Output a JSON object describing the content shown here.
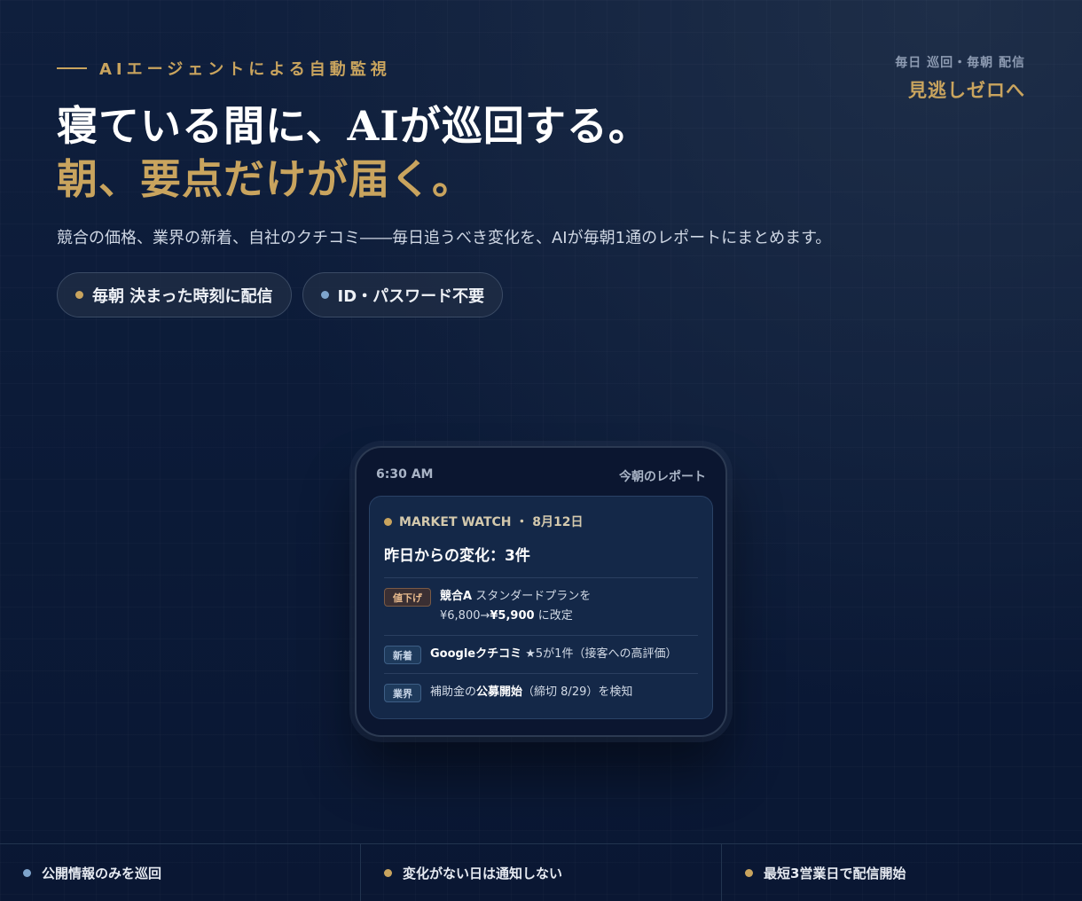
{
  "hero": {
    "eyebrow": "AIエージェントによる自動監視",
    "corner_sub": "毎日 巡回・毎朝 配信",
    "corner_main": "見逃しゼロへ",
    "headline_line1": "寝ている間に、AIが巡回する。",
    "headline_line2": "朝、要点だけが届く。",
    "lead": "競合の価格、業界の新着、自社のクチコミ――毎日追うべき変化を、AIが毎朝1通のレポートにまとめます。",
    "pills": [
      {
        "label": "毎朝 決まった時刻に配信",
        "dot_color": "#c9a45e"
      },
      {
        "label": "ID・パスワード不要",
        "dot_color": "#7ea4cc"
      }
    ]
  },
  "phone": {
    "time": "6:30 AM",
    "title": "今朝のレポート",
    "card": {
      "source": "MARKET WATCH ・ 8月12日",
      "headline": "昨日からの変化：3件",
      "items": [
        {
          "tag": "値下げ",
          "subject": "競合A",
          "text1": " スタンダードプランを",
          "text2a": "¥6,800→",
          "text2b": "¥5,900",
          "text2c": " に改定"
        },
        {
          "tag": "新着",
          "subject": "Googleクチコミ",
          "text": " ★5が1件（接客への高評価）"
        },
        {
          "tag": "業界",
          "pre": "補助金の",
          "bold": "公募開始",
          "post": "（締切 8/29）を検知"
        }
      ]
    }
  },
  "footer": {
    "items": [
      {
        "label": "公開情報のみを巡回",
        "dot_color": "#7ea4cc"
      },
      {
        "label": "変化がない日は通知しない",
        "dot_color": "#c9a45e"
      },
      {
        "label": "最短3営業日で配信開始",
        "dot_color": "#c9a45e"
      }
    ]
  },
  "colors": {
    "gold": "#c9a45e",
    "blue_dot": "#7ea4cc",
    "background": "#0c1b38",
    "card": "#142848"
  }
}
